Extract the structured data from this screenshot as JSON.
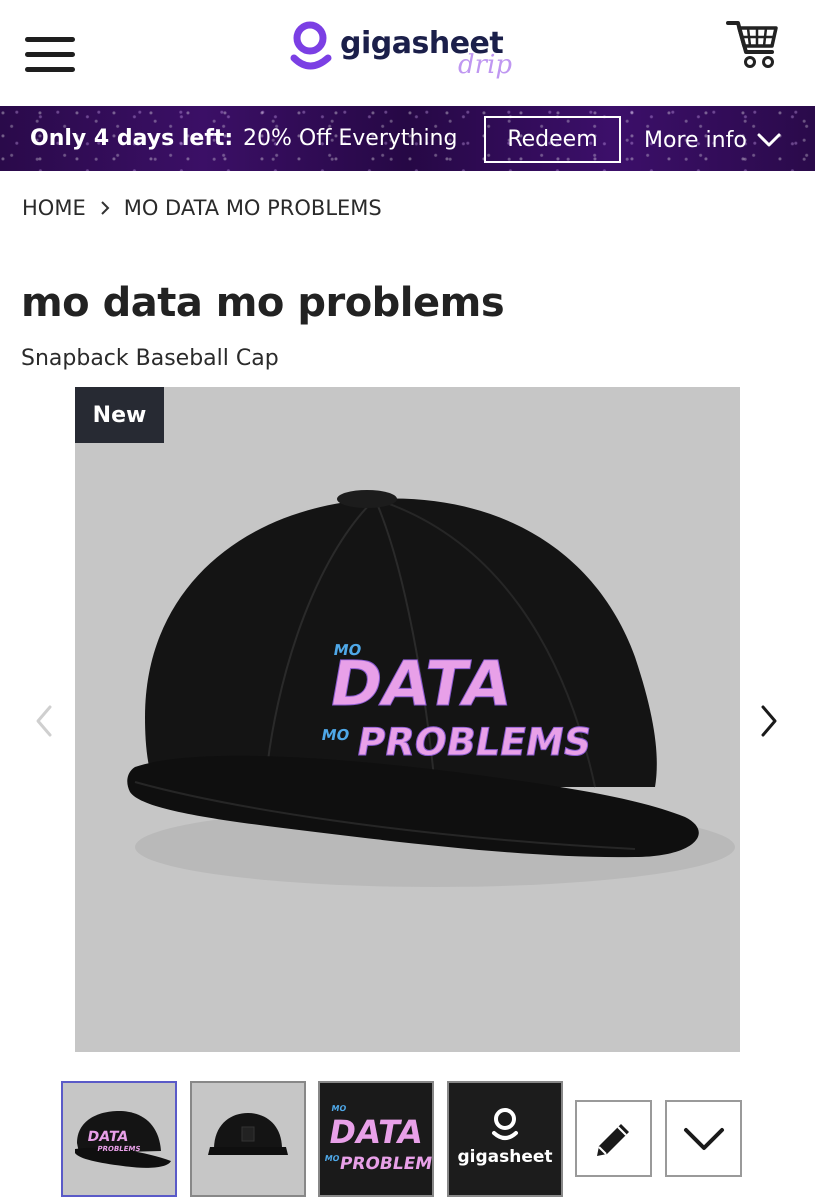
{
  "header": {
    "logo_text": "gigasheet",
    "logo_sub": "drip"
  },
  "promo": {
    "bold_text": "Only 4 days left:",
    "offer_text": "20% Off Everything",
    "redeem_label": "Redeem",
    "more_info_label": "More info"
  },
  "breadcrumb": {
    "items": [
      "HOME",
      "MO DATA MO PROBLEMS"
    ]
  },
  "product": {
    "title": "mo data mo problems",
    "subtitle": "Snapback Baseball Cap",
    "badge": "New",
    "print_small_1": "MO",
    "print_big_1": "DATA",
    "print_small_2": "MO",
    "print_big_2": "PROBLEMS"
  },
  "thumbnails": [
    {
      "kind": "cap-front",
      "active": true
    },
    {
      "kind": "cap-back",
      "active": false
    },
    {
      "kind": "print-closeup",
      "active": false
    },
    {
      "kind": "logo-closeup",
      "label": "gigasheet",
      "active": false
    }
  ],
  "colors": {
    "promo_bg": "#3b0f66",
    "badge_bg": "#272a33",
    "image_bg": "#c6c6c6",
    "print_pink": "#e8a0e8",
    "print_blue": "#4fa8e8",
    "logo_purple": "#7b3fe4",
    "logo_navy": "#1b1f4a"
  },
  "icons": [
    "menu-icon",
    "cart-icon",
    "chevron-right-icon",
    "chevron-down-icon",
    "pencil-icon"
  ]
}
